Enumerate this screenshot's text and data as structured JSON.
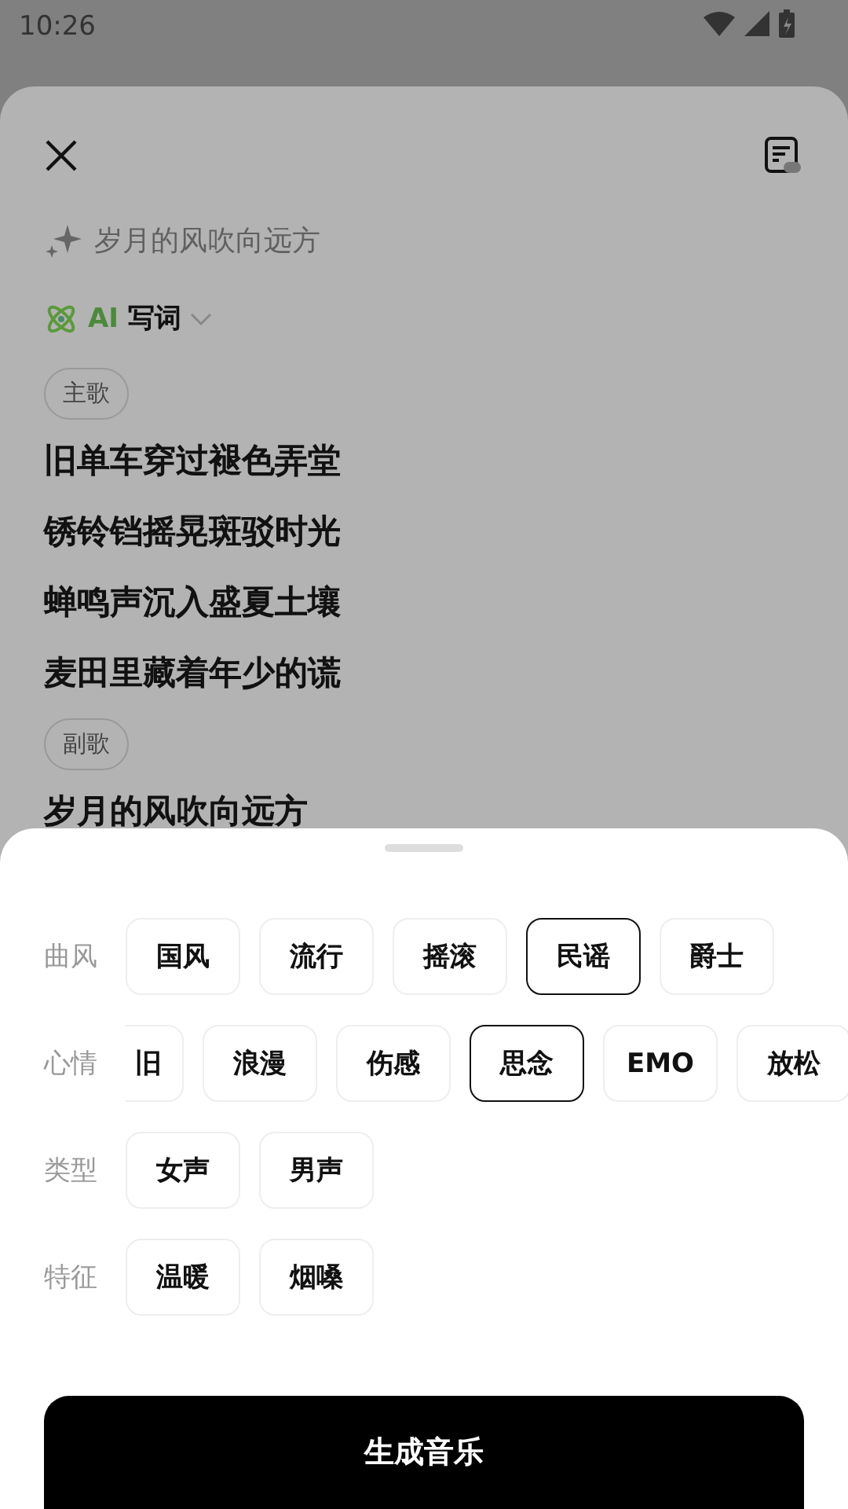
{
  "status_bar": {
    "time": "10:26"
  },
  "prompt": {
    "text": "岁月的风吹向远方"
  },
  "mode": {
    "label_accent": "AI",
    "label": "写词"
  },
  "lyrics": [
    {
      "kind": "section",
      "text": "主歌"
    },
    {
      "kind": "line",
      "text": "旧单车穿过褪色弄堂"
    },
    {
      "kind": "line",
      "text": "锈铃铛摇晃斑驳时光"
    },
    {
      "kind": "line",
      "text": "蝉鸣声沉入盛夏土壤"
    },
    {
      "kind": "line",
      "text": "麦田里藏着年少的谎"
    },
    {
      "kind": "section",
      "text": "副歌"
    },
    {
      "kind": "line",
      "text": "岁月的风吹向远方"
    }
  ],
  "options": [
    {
      "label": "曲风",
      "chips": [
        {
          "text": "国风",
          "selected": false
        },
        {
          "text": "流行",
          "selected": false
        },
        {
          "text": "摇滚",
          "selected": false
        },
        {
          "text": "民谣",
          "selected": true
        },
        {
          "text": "爵士",
          "selected": false
        }
      ]
    },
    {
      "label": "心情",
      "chips": [
        {
          "text": "旧",
          "selected": false,
          "kind": "cut"
        },
        {
          "text": "浪漫",
          "selected": false
        },
        {
          "text": "伤感",
          "selected": false
        },
        {
          "text": "思念",
          "selected": true
        },
        {
          "text": "EMO",
          "selected": false
        },
        {
          "text": "放松",
          "selected": false
        }
      ]
    },
    {
      "label": "类型",
      "chips": [
        {
          "text": "女声",
          "selected": false
        },
        {
          "text": "男声",
          "selected": false
        }
      ]
    },
    {
      "label": "特征",
      "chips": [
        {
          "text": "温暖",
          "selected": false
        },
        {
          "text": "烟嗓",
          "selected": false
        }
      ]
    }
  ],
  "generate_button": "生成音乐"
}
